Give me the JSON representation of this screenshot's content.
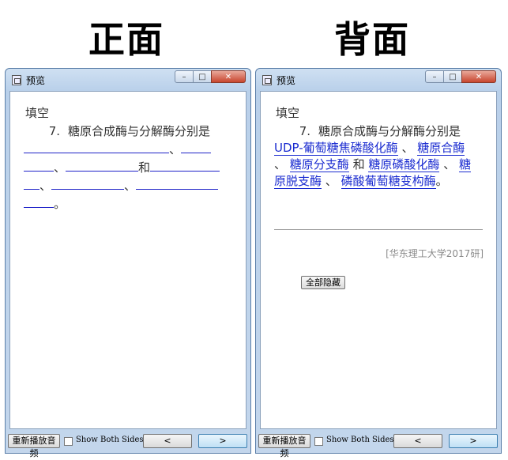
{
  "titles": {
    "front": "正面",
    "back": "背面"
  },
  "window": {
    "title": "预览"
  },
  "card": {
    "label": "填空",
    "question_number": "7.",
    "question_text": "糖原合成酶与分解酶分别是",
    "answers": [
      "UDP-葡萄糖焦磷酸化酶",
      "糖原合酶",
      "糖原分支酶",
      "糖原磷酸化酶",
      "糖原脱支酶",
      "磷酸葡萄糖变构酶"
    ],
    "separators": {
      "comma": "、",
      "and": "和",
      "end": "。"
    },
    "source": "[华东理工大学2017研]",
    "hide_all_label": "全部隐藏"
  },
  "bottom_bar": {
    "replay_label": "重新播放音频",
    "show_both_label": "Show Both Sides",
    "prev_label": "<",
    "next_label": ">"
  },
  "colors": {
    "answer_link": "#1a2bd0",
    "source_text": "#8a8a8a"
  }
}
